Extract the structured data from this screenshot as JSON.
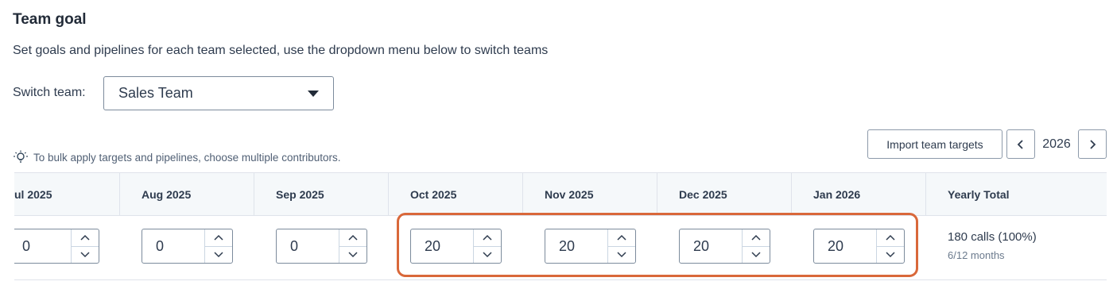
{
  "page": {
    "title": "Team goal",
    "subtitle": "Set goals and pipelines for each team selected, use the dropdown menu below to switch teams"
  },
  "switch_team": {
    "label": "Switch team:",
    "selected": "Sales Team"
  },
  "hint": "To bulk apply targets and pipelines, choose multiple contributors.",
  "toolbar": {
    "import_label": "Import team targets",
    "year": "2026"
  },
  "table": {
    "columns": [
      "ul 2025",
      "Aug 2025",
      "Sep 2025",
      "Oct 2025",
      "Nov 2025",
      "Dec 2025",
      "Jan 2026",
      "Yearly Total"
    ],
    "values": [
      "0",
      "0",
      "0",
      "20",
      "20",
      "20",
      "20"
    ],
    "total": {
      "main": "180 calls (100%)",
      "sub": "6/12 months"
    }
  },
  "colors": {
    "highlight": "#d9683a",
    "header_bg": "#f5f8fa"
  }
}
